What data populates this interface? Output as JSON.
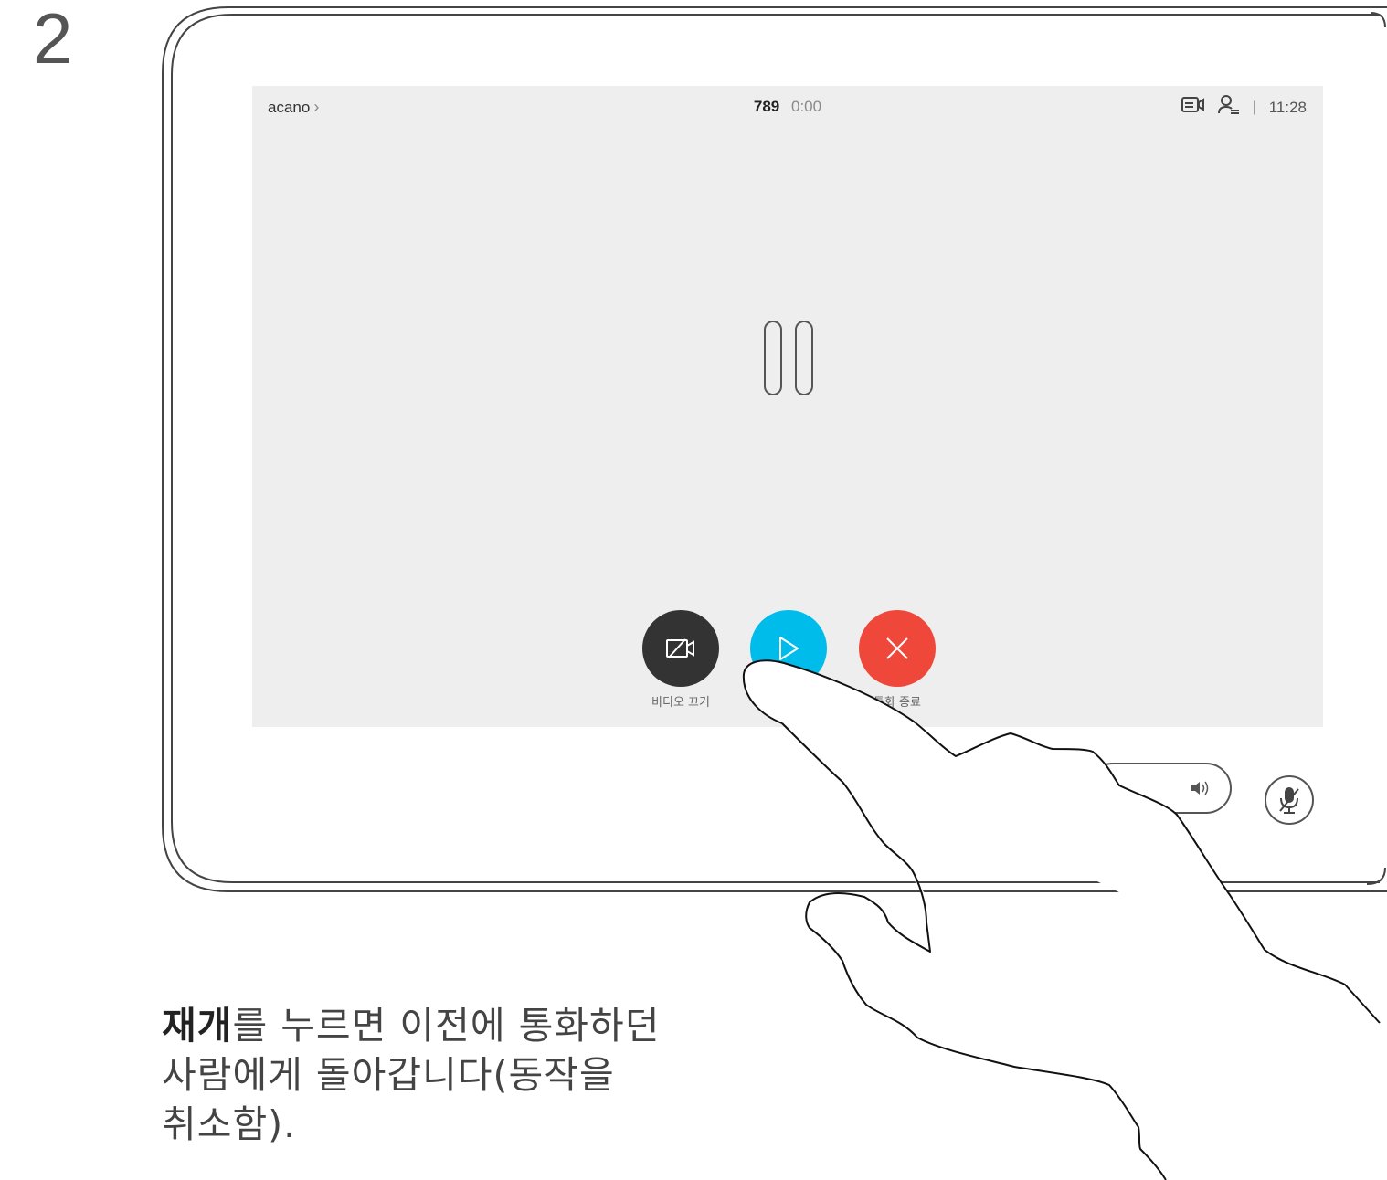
{
  "step": {
    "number": "2"
  },
  "screen": {
    "header": {
      "contact_name": "acano",
      "call_number": "789",
      "call_timer": "0:00",
      "clock": "11:28",
      "divider": "|"
    },
    "status": "on-hold",
    "controls": [
      {
        "id": "video-off",
        "label": "비디오 끄기",
        "icon": "camera-off-icon",
        "color": "#333333"
      },
      {
        "id": "resume",
        "label": "",
        "icon": "play-icon",
        "color": "#00bceb"
      },
      {
        "id": "end-call",
        "label": "통화 종료",
        "icon": "close-icon",
        "color": "#f0473b"
      }
    ]
  },
  "device_controls": {
    "volume_icon": "speaker-icon",
    "mute_icon": "mic-muted-icon"
  },
  "caption": {
    "bold_part": "재개",
    "line1_rest": "를 누르면 이전에 통화하던",
    "line2": "사람에게 돌아갑니다(동작을",
    "line3": "취소함)."
  }
}
